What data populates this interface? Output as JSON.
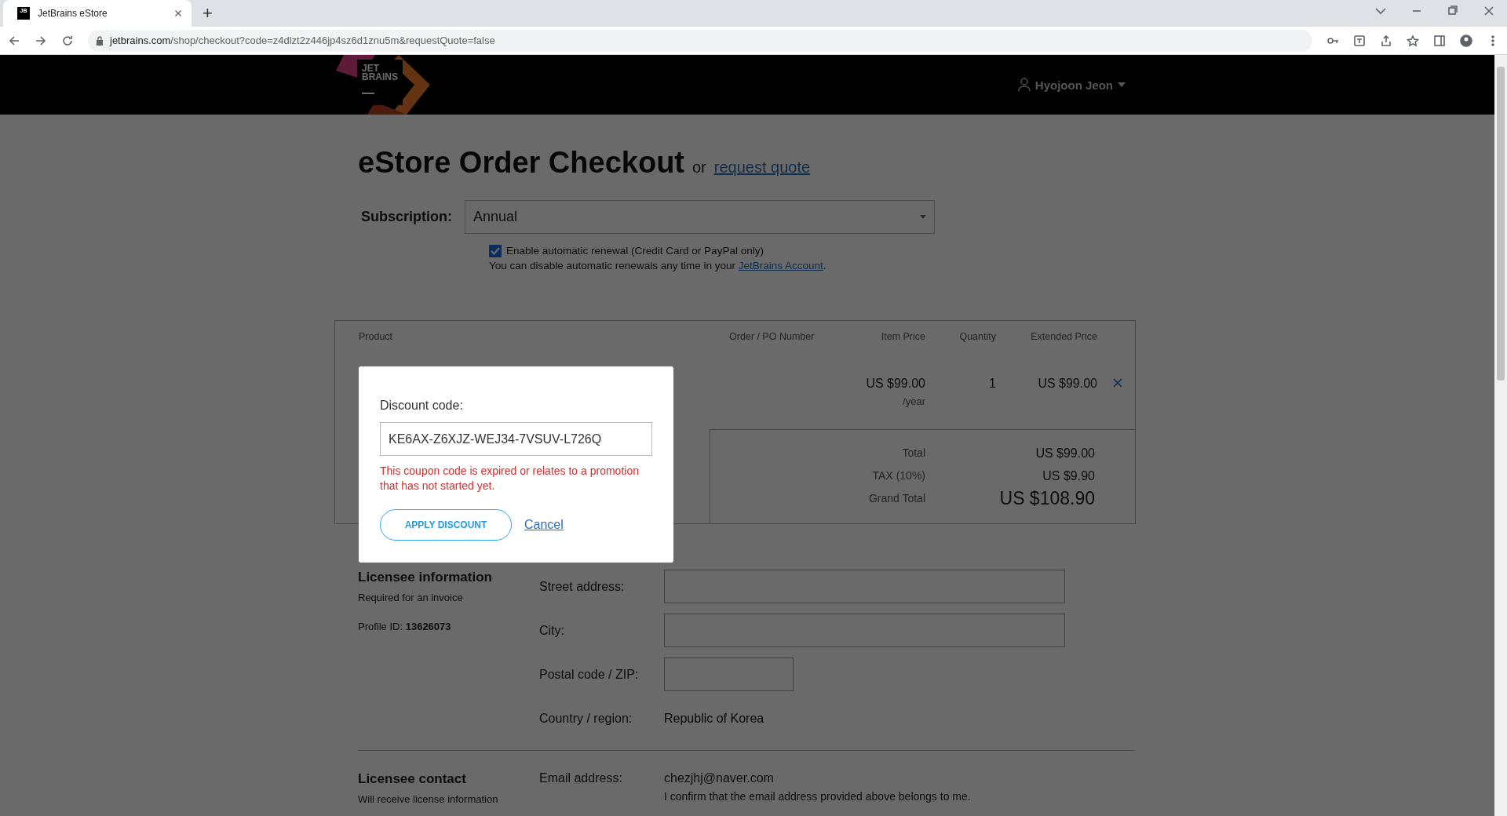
{
  "browser": {
    "tab": {
      "title": "JetBrains eStore",
      "favicon": "JB",
      "selected": true
    },
    "new_tab": "+",
    "url": {
      "host": "jetbrains.com",
      "path": "/shop/checkout?code=z4dlzt2z446jp4sz6d1znu5m&requestQuote=false"
    }
  },
  "header": {
    "logo": [
      "JET",
      "BRAINS"
    ],
    "user": "Hyojoon Jeon"
  },
  "title": "eStore Order Checkout",
  "title_or": "or",
  "request_quote_link": "request quote",
  "subscription": {
    "label": "Subscription:",
    "value": "Annual",
    "auto_renewal": {
      "label": "Enable automatic renewal (Credit Card or PayPal only)",
      "checked": true
    },
    "note": "You can disable automatic renewals any time in your",
    "note_link": "JetBrains Account",
    "note_end": "."
  },
  "table": {
    "columns": [
      "Product",
      "Order / PO Number",
      "Item Price",
      "Quantity",
      "Extended Price"
    ],
    "rows": [
      {
        "item_price": "US $99.00",
        "period": "/year",
        "quantity": "1",
        "extended_price": "US $99.00"
      }
    ]
  },
  "totals": [
    {
      "label": "Total",
      "value": "US $99.00",
      "kind": "normal"
    },
    {
      "label": "TAX (10%)",
      "value": "US $9.90",
      "kind": "normal"
    },
    {
      "label": "Grand Total",
      "value": "US $108.90",
      "kind": "grand"
    }
  ],
  "licensee_information": {
    "title": "Licensee information",
    "subtitle": "Required for an invoice",
    "profile": "Profile ID: **13626073**",
    "fields": [
      {
        "label": "Street address:",
        "kind": "input"
      },
      {
        "label": "City:",
        "kind": "input"
      },
      {
        "label": "Postal code / ZIP:",
        "kind": "short_input"
      },
      {
        "label": "Country / region:",
        "kind": "text",
        "value": "Republic of Korea"
      }
    ]
  },
  "licensee_contact": {
    "title": "Licensee contact",
    "subtitle": "Will receive license information",
    "email_label": "Email address:",
    "email": "chezjhj@naver.com",
    "confirm": "I confirm that the email address provided above belongs to me."
  },
  "dialog": {
    "label": "Discount code:",
    "value": "KE6AX-Z6XJZ-WEJ34-7VSUV-L726Q",
    "error": "This coupon code is expired or relates to a promotion that has not started yet.",
    "apply": "APPLY DISCOUNT",
    "cancel": "Cancel"
  }
}
